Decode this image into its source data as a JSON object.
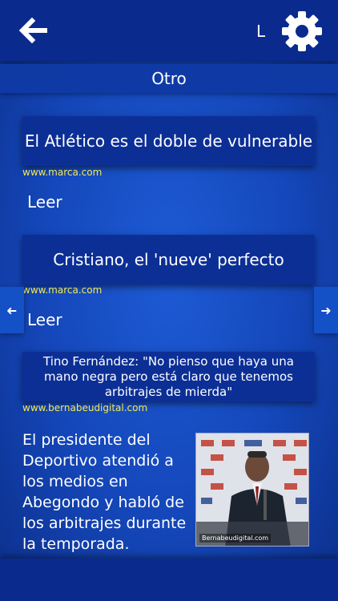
{
  "header": {
    "back_icon": "arrow-left-icon",
    "title_partial": "L",
    "settings_icon": "gear-icon"
  },
  "section": {
    "label": "Otro"
  },
  "articles": [
    {
      "headline": "El Atlético es el doble de vulnerable",
      "source": "www.marca.com",
      "read_label": "Leer"
    },
    {
      "headline": "Cristiano, el 'nueve' perfecto",
      "source": "www.marca.com",
      "read_label": "Leer"
    },
    {
      "headline": "Tino Fernández: \"No pienso que haya una mano negra pero está claro que tenemos arbitrajes de mierda\"",
      "source": "www.bernabeudigital.com",
      "summary": "El presidente del Deportivo atendió a los medios en Abegondo y habló de los arbitrajes durante la temporada.",
      "image_caption": "Bernabeudigital.com"
    }
  ],
  "nav": {
    "prev_icon": "arrow-left-small-icon",
    "next_icon": "arrow-right-small-icon"
  },
  "colors": {
    "accent_bar": "#0b2a8e",
    "source_text": "#f2e85a",
    "background": "#1446b8"
  }
}
